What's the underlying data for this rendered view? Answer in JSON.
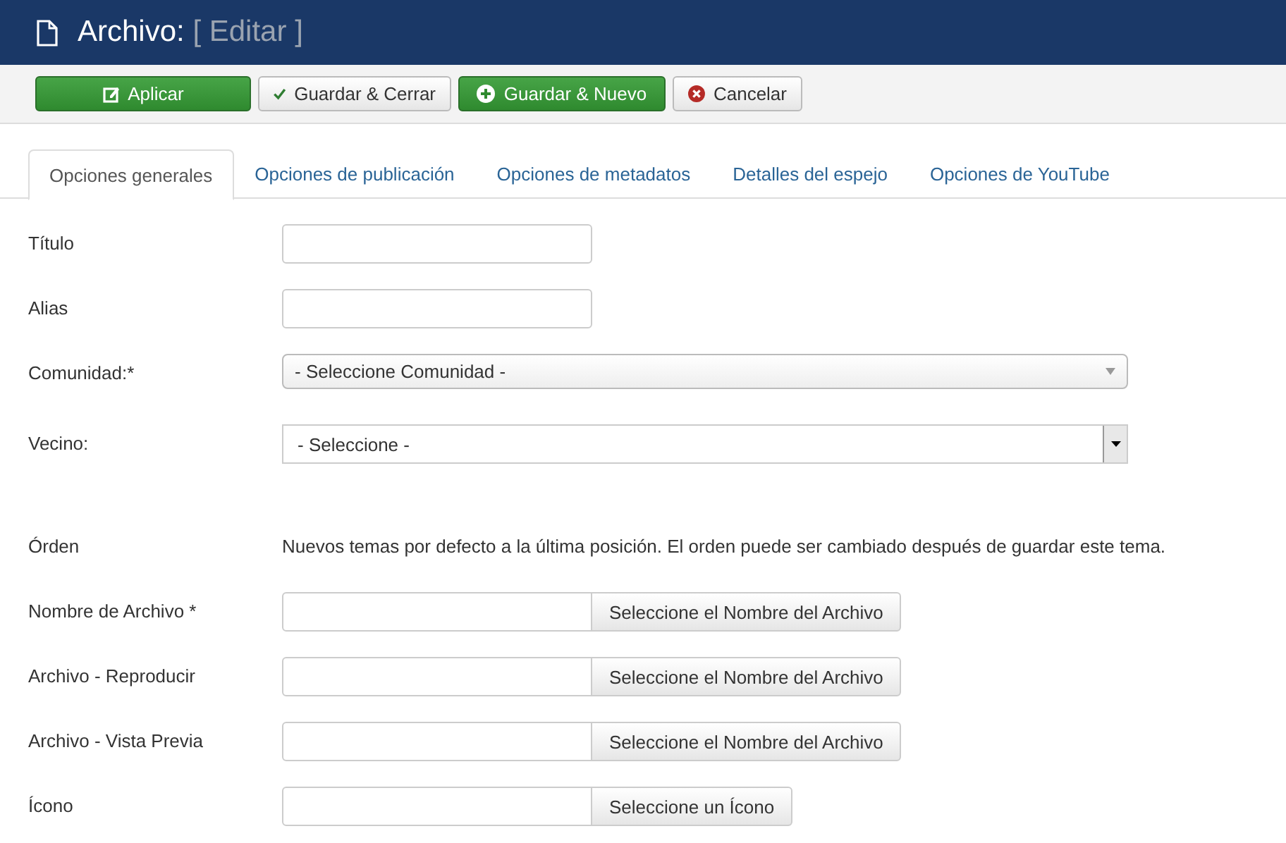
{
  "header": {
    "title": "Archivo:",
    "subtitle": "[ Editar ]"
  },
  "toolbar": [
    {
      "label": "Aplicar",
      "kind": "success"
    },
    {
      "label": "Guardar & Cerrar",
      "kind": "default"
    },
    {
      "label": "Guardar & Nuevo",
      "kind": "success"
    },
    {
      "label": "Cancelar",
      "kind": "default"
    }
  ],
  "tabs": [
    {
      "label": "Opciones generales",
      "selected": true
    },
    {
      "label": "Opciones de publicación",
      "selected": false
    },
    {
      "label": "Opciones de metadatos",
      "selected": false
    },
    {
      "label": "Detalles del espejo",
      "selected": false
    },
    {
      "label": "Opciones de YouTube",
      "selected": false
    }
  ],
  "fields": [
    {
      "kind": "text",
      "label": "Título"
    },
    {
      "kind": "text",
      "label": "Alias"
    },
    {
      "kind": "select",
      "label": "Comunidad:*",
      "value": "- Seleccione Comunidad -"
    },
    {
      "kind": "dropdown",
      "label": "Vecino:",
      "value": "- Seleccione -"
    },
    {
      "kind": "note",
      "label": "Órden",
      "text": "Nuevos temas por defecto a la última posición. El orden puede ser cambiado después de guardar este tema."
    },
    {
      "kind": "file",
      "label": "Nombre de Archivo *",
      "button": "Seleccione el Nombre del Archivo"
    },
    {
      "kind": "file",
      "label": "Archivo - Reproducir",
      "button": "Seleccione el Nombre del Archivo"
    },
    {
      "kind": "file",
      "label": "Archivo - Vista Previa",
      "button": "Seleccione el Nombre del Archivo"
    },
    {
      "kind": "file",
      "label": "Ícono",
      "button": "Seleccione un Ícono"
    }
  ]
}
